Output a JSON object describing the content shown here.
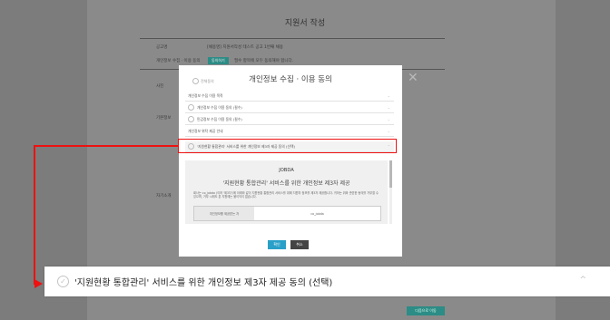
{
  "page": {
    "title": "지원서 작성"
  },
  "background": {
    "label_name": "공고명",
    "label_consent": "개인정보 수집 · 이용 동의",
    "value_name": "[채용명] 지원서작성 테스트 공고 1번째 채용",
    "consent_button": "동의하기",
    "consent_note": "필수 항목에 모두 동의해야 합니다.",
    "section_photo": "사진",
    "section_basic": "기본정보",
    "section_resume": "자기소개",
    "next_button": "다음으로 이동"
  },
  "modal": {
    "check_all": "전체동의",
    "title": "개인정보 수집 · 이용 동의",
    "rows": [
      {
        "label": "개인정보 수집 이용 목적"
      },
      {
        "label": "개인정보 수집 이용 동의 (필수)"
      },
      {
        "label": "민감정보 수집 이용 동의 (필수)"
      },
      {
        "label": "개인정보 위탁 제공 안내"
      },
      {
        "label": "'지원현황 통합관리' 서비스를 위한 개인정보 제3자 제공 동의 (선택)"
      }
    ],
    "content": {
      "brand": "JOBDA",
      "heading": "'지원현황 통합관리' 서비스를 위한 개인정보 제3자 제공",
      "body": "회사는 co_jobda (이하 '제3자')에 아래와 같이 지원현황 통합관리 서비스를 위해 지원자 정보를 제3자 제공합니다. 귀하는 위와 관련한 동의를 거부할 수 있으며, 거부 시에도 본 지원에는 불이익이 없습니다.",
      "table_col1": "개인정보를 제공받는 자",
      "table_col2": "co_jobda"
    },
    "confirm_button": "확인",
    "cancel_button": "취소"
  },
  "callout": {
    "text": "'지원현황 통합관리' 서비스를 위한 개인정보 제3자 제공 동의 (선택)"
  },
  "colors": {
    "highlight": "#e11111",
    "teal": "#2c8c86",
    "confirm": "#2aa0c8"
  }
}
